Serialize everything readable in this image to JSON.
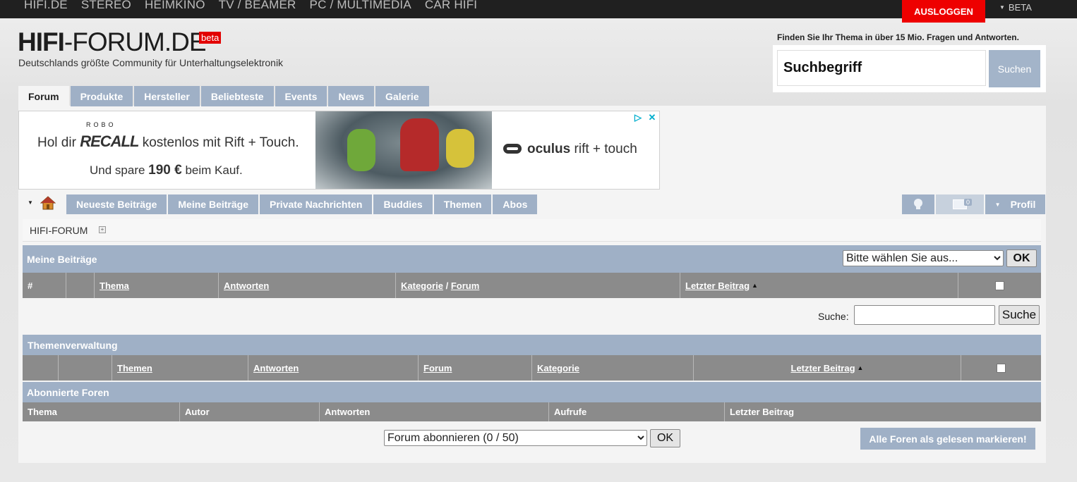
{
  "topnav": [
    "HIFI.DE",
    "STEREO",
    "HEIMKINO",
    "TV / BEAMER",
    "PC / MULTIMEDIA",
    "CAR HIFI"
  ],
  "header": {
    "logout": "AUSLOGGEN",
    "beta_menu": "BETA",
    "logo_bold": "HIFI",
    "logo_rest": "-FORUM.DE",
    "logo_badge": "beta",
    "tagline": "Deutschlands größte Community für Unterhaltungselektronik",
    "search_hint": "Finden Sie Ihr Thema in über 15 Mio. Fragen und Antworten.",
    "search_value": "Suchbegriff",
    "search_button": "Suchen"
  },
  "main_tabs": [
    "Forum",
    "Produkte",
    "Hersteller",
    "Beliebteste",
    "Events",
    "News",
    "Galerie"
  ],
  "ad": {
    "robo": "ROBO",
    "line1_pre": "Hol dir",
    "line1_brand": "RECALL",
    "line1_post": "kostenlos mit Rift + Touch.",
    "line2_pre": "Und spare",
    "line2_amount": "190 €",
    "line2_post": "beim Kauf.",
    "oculus_brand": "oculus",
    "oculus_product": "rift + touch"
  },
  "sub_tabs": [
    "Neueste Beiträge",
    "Meine Beiträge",
    "Private Nachrichten",
    "Buddies",
    "Themen",
    "Abos"
  ],
  "right_tabs": {
    "message_count": "0",
    "profil": "Profil"
  },
  "breadcrumb": "HIFI-FORUM",
  "meine_beitraege": {
    "title": "Meine Beiträge",
    "select_value": "Bitte wählen Sie aus...",
    "ok": "OK",
    "col_hash": "#",
    "col_thema": "Thema",
    "col_antworten": "Antworten",
    "col_kategorie": "Kategorie",
    "col_sep": "/",
    "col_forum": "Forum",
    "col_letzter": "Letzter Beitrag",
    "search_label": "Suche:",
    "search_button": "Suche"
  },
  "themenverwaltung": {
    "title": "Themenverwaltung",
    "col_themen": "Themen",
    "col_antworten": "Antworten",
    "col_forum": "Forum",
    "col_kategorie": "Kategorie",
    "col_letzter": "Letzter Beitrag"
  },
  "abonnierte_foren": {
    "title": "Abonnierte Foren",
    "col_thema": "Thema",
    "col_autor": "Autor",
    "col_antworten": "Antworten",
    "col_aufrufe": "Aufrufe",
    "col_letzter": "Letzter Beitrag",
    "select_value": "Forum abonnieren (0 / 50)",
    "ok": "OK",
    "mark_all": "Alle Foren als gelesen markieren!"
  }
}
